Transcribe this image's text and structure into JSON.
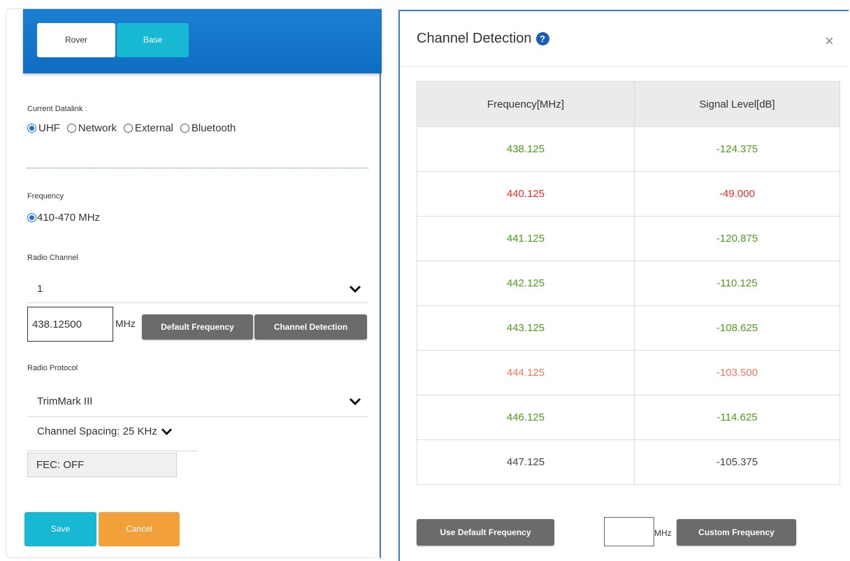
{
  "left": {
    "mode_buttons": [
      "Rover",
      "Base"
    ],
    "datalink_label": "Current Datalink :",
    "datalink_options": [
      "UHF",
      "Network",
      "External",
      "Bluetooth"
    ],
    "frequency_label": "Frequency",
    "frequency_option": "410-470 MHz",
    "radio_channel_label": "Radio Channel",
    "radio_channel_value": "1",
    "freq_input_value": "438.12500",
    "freq_unit": "MHz",
    "default_freq_btn": "Default Frequency",
    "channel_detect_btn": "Channel Detection",
    "protocol_label": "Radio Protocol",
    "protocol_value": "TrimMark III",
    "channel_spacing": "Channel Spacing: 25 KHz",
    "fec": "FEC: OFF",
    "save": "Save",
    "cancel": "Cancel"
  },
  "modal": {
    "title": "Channel Detection",
    "help_icon": "question-circle-icon",
    "close_symbol": "×",
    "headers": [
      "Frequency[MHz]",
      "Signal Level[dB]"
    ],
    "rows": [
      {
        "freq": "438.125",
        "level": "-124.375",
        "color": "#4e9a1f"
      },
      {
        "freq": "440.125",
        "level": "-49.000",
        "color": "#ee2b2b"
      },
      {
        "freq": "441.125",
        "level": "-120.875",
        "color": "#4e9a1f"
      },
      {
        "freq": "442.125",
        "level": "-110.125",
        "color": "#4e9a1f"
      },
      {
        "freq": "443.125",
        "level": "-108.625",
        "color": "#4e9a1f"
      },
      {
        "freq": "444.125",
        "level": "-103.500",
        "color": "#f07a5a"
      },
      {
        "freq": "446.125",
        "level": "-114.625",
        "color": "#4e9a1f"
      },
      {
        "freq": "447.125",
        "level": "-105.375",
        "color": "#444444"
      }
    ],
    "use_default_btn": "Use Default Frequency",
    "custom_unit": "MHz",
    "custom_btn": "Custom Frequency"
  },
  "colors": {
    "brand_blue": "#1b7fd1",
    "accent_cyan": "#17b8d1",
    "cancel_orange": "#f2a13a",
    "button_gray": "#6b6b6b"
  }
}
